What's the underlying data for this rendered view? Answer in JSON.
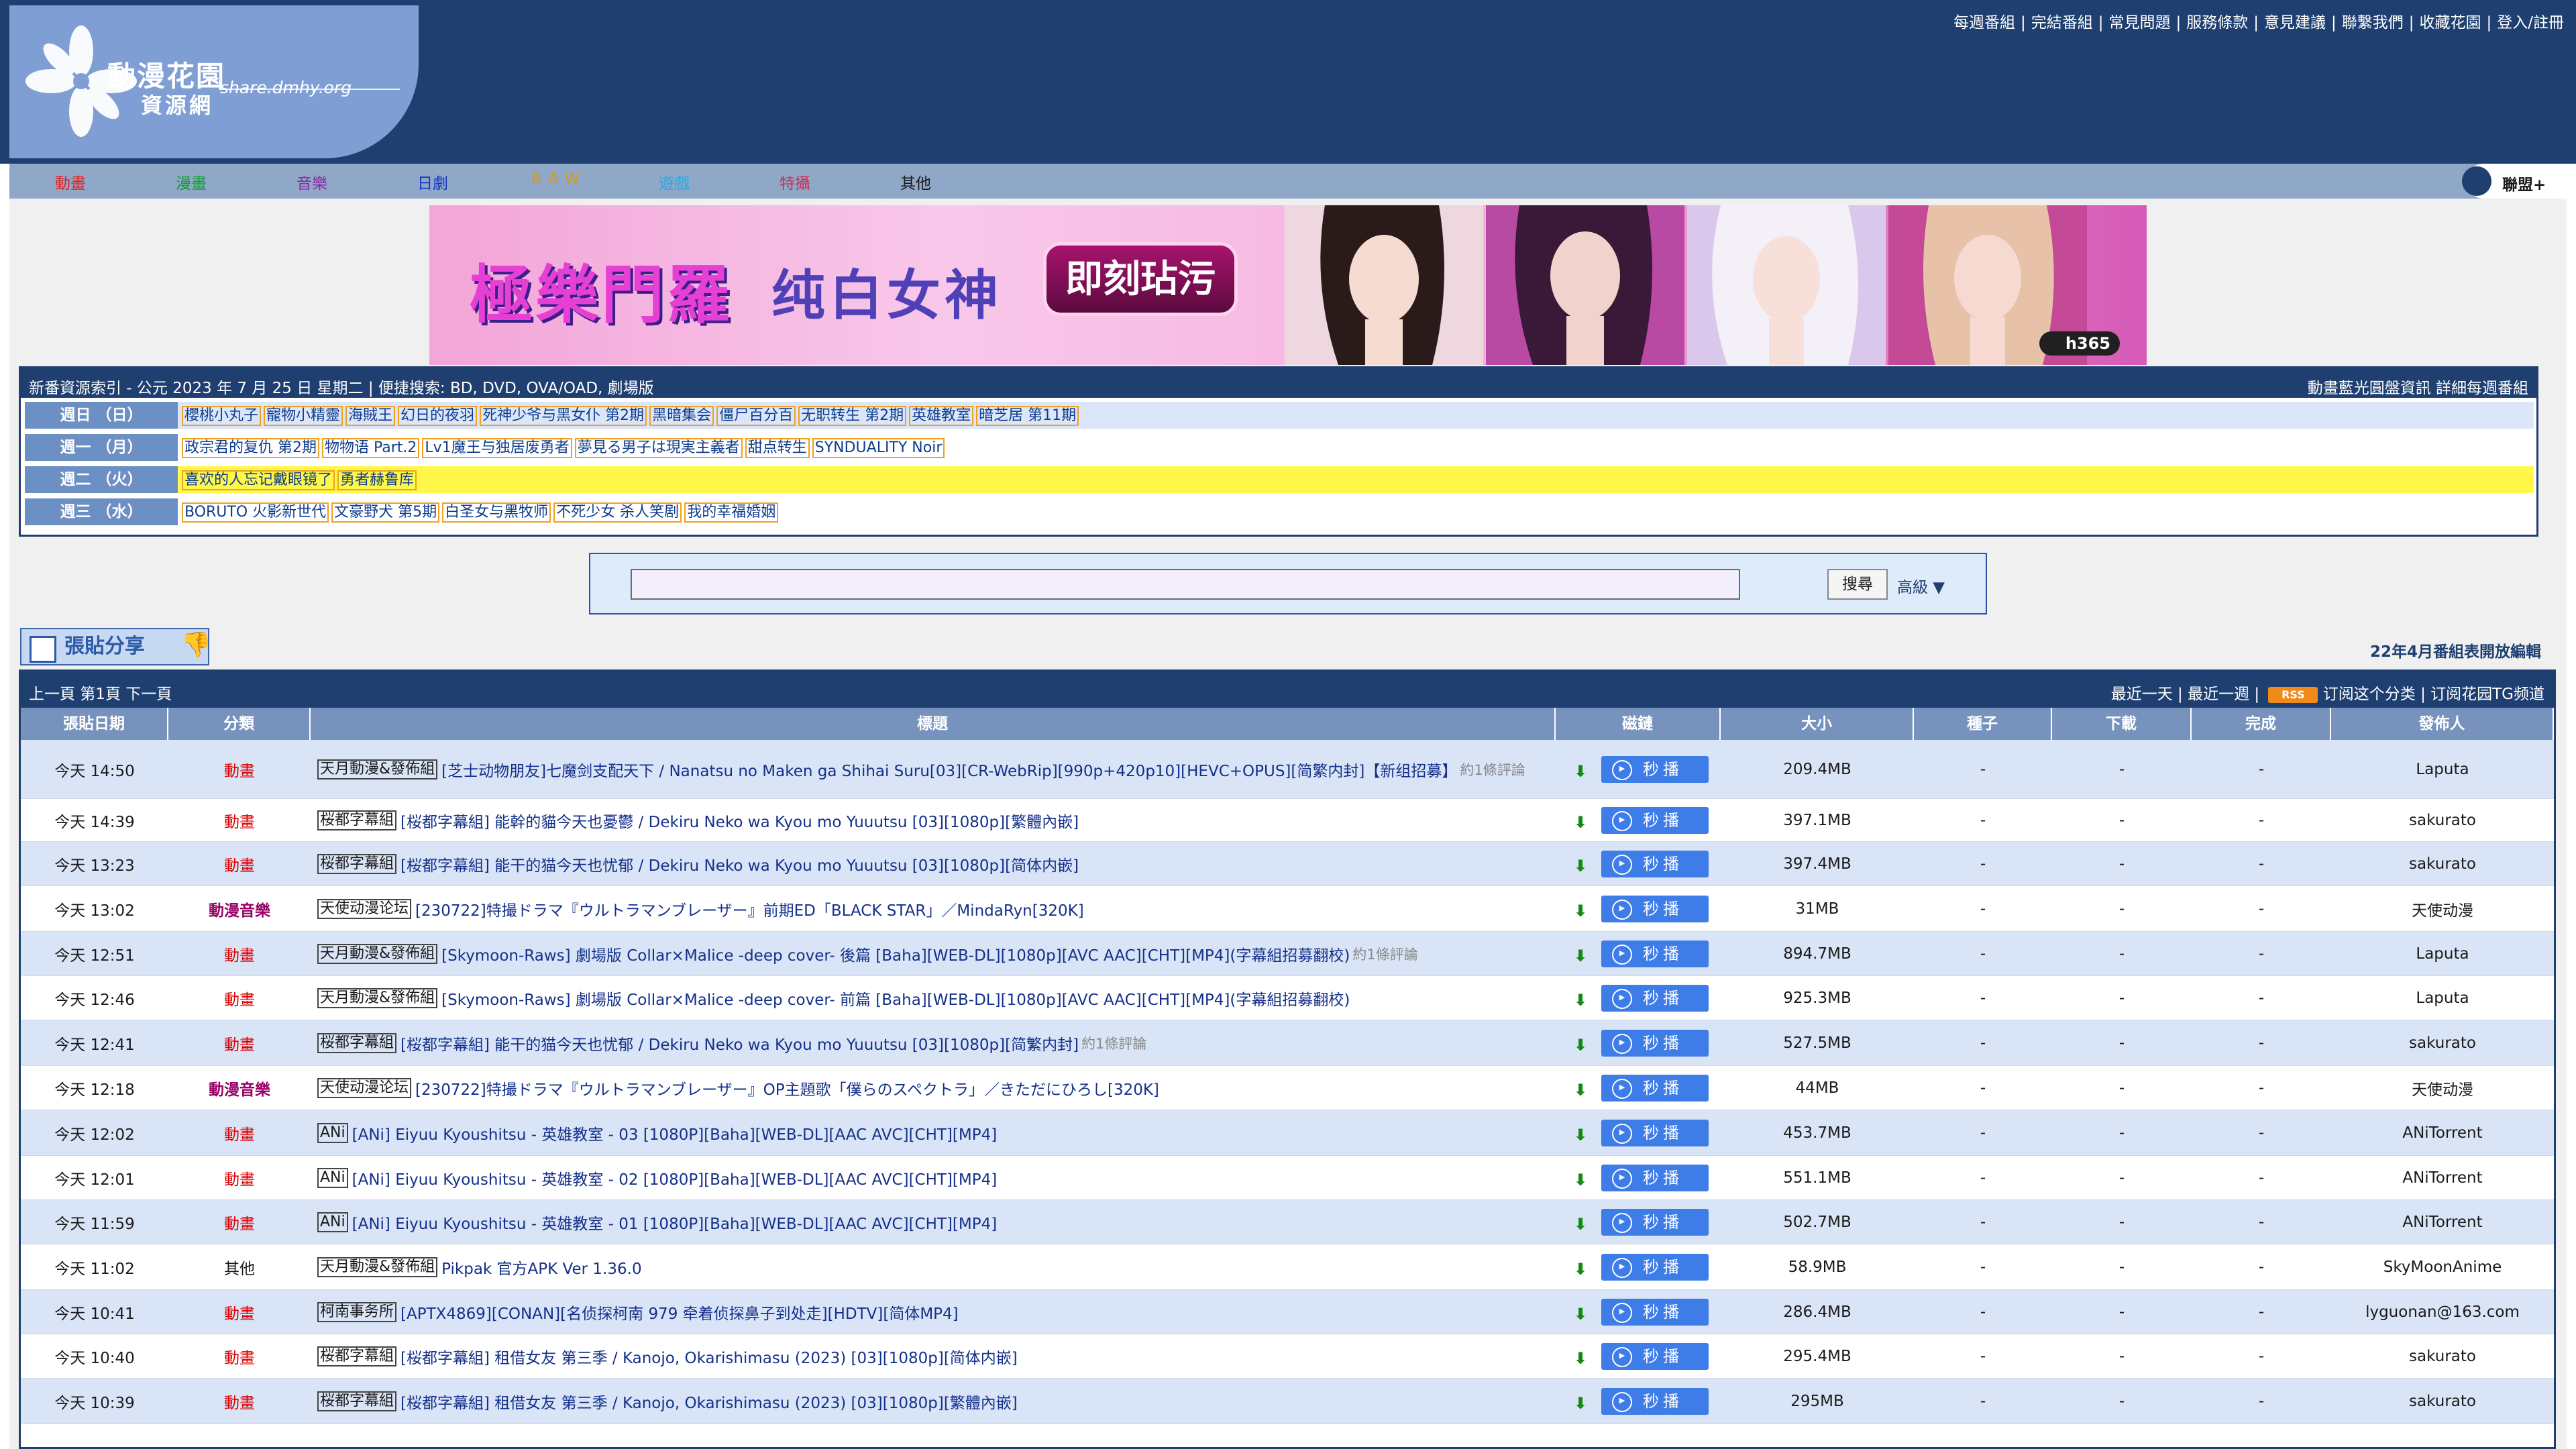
{
  "site": {
    "logo_title": "動漫花園",
    "logo_sub": "資源網",
    "logo_domain": "share.dmhy.org"
  },
  "top_links": [
    "每週番組",
    "完結番組",
    "常見問題",
    "服務條款",
    "意見建議",
    "聯繫我們",
    "收藏花園",
    "登入/註冊"
  ],
  "nav": {
    "items": [
      {
        "label": "動畫",
        "color": "#e02020"
      },
      {
        "label": "漫畫",
        "color": "#13a02a"
      },
      {
        "label": "音樂",
        "color": "#8a2aa8"
      },
      {
        "label": "日劇",
        "color": "#1437c8"
      },
      {
        "label": "RAW",
        "color": "#d89a18"
      },
      {
        "label": "遊戲",
        "color": "#2aa8e0"
      },
      {
        "label": "特攝",
        "color": "#c8305a"
      },
      {
        "label": "其他",
        "color": "#1a1a1a"
      }
    ],
    "alliance": "聯盟+"
  },
  "banner": {
    "brand": "極樂門羅",
    "slogan": "纯白女神",
    "cta": "即刻玷污",
    "tag": "h365"
  },
  "schedule": {
    "header": "新番資源索引 - 公元 2023 年 7 月 25 日 星期二 | 便捷搜索: BD, DVD, OVA/OAD, 劇場版",
    "header_right": "動畫藍光圓盤資訊 詳細每週番組",
    "days": [
      {
        "label": "週日 （日）",
        "shows": [
          "櫻桃小丸子",
          "寵物小精靈",
          "海賊王",
          "幻日的夜羽",
          "死神少爷与黑女仆 第2期",
          "黑暗集会",
          "僵尸百分百",
          "无职转生 第2期",
          "英雄教室",
          "暗芝居 第11期"
        ]
      },
      {
        "label": "週一 （月）",
        "shows": [
          "政宗君的复仇 第2期",
          "物物语 Part.2",
          "Lv1魔王与独居废勇者",
          "夢見る男子は現実主義者",
          "甜点转生",
          "SYNDUALITY Noir"
        ]
      },
      {
        "label": "週二 （火）",
        "shows": [
          "喜欢的人忘记戴眼镜了",
          "勇者赫鲁库"
        ]
      },
      {
        "label": "週三 （水）",
        "shows": [
          "BORUTO 火影新世代",
          "文豪野犬 第5期",
          "白圣女与黑牧师",
          "不死少女 杀人笑剧",
          "我的幸福婚姻"
        ]
      }
    ]
  },
  "search": {
    "placeholder": "",
    "button": "搜尋",
    "advanced": "高級 ▼"
  },
  "post_share": "張貼分享",
  "open_notice": "22年4月番組表開放編輯",
  "pager": {
    "left": "上一頁 第1頁 下一頁",
    "recent_day": "最近一天",
    "recent_week": "最近一週",
    "rss": "RSS",
    "subscribe": "订阅这个分类",
    "tg": "订阅花园TG频道"
  },
  "columns": [
    "張貼日期",
    "分類",
    "標題",
    "磁鏈",
    "大小",
    "種子",
    "下載",
    "完成",
    "發佈人"
  ],
  "play_label": "秒播",
  "rows": [
    {
      "date": "今天 14:50",
      "category": "動畫",
      "cat_type": "anime",
      "team": "天月動漫&發佈組",
      "title": "[芝士动物朋友]七魔剑支配天下 / Nanatsu no Maken ga Shihai Suru[03][CR-WebRip][990p+420p10][HEVC+OPUS][简繁内封]【新组招募】",
      "comment": "約1條評論",
      "size": "209.4MB",
      "seeds": "-",
      "downloads": "-",
      "done": "-",
      "publisher": "Laputa"
    },
    {
      "date": "今天 14:39",
      "category": "動畫",
      "cat_type": "anime",
      "team": "桜都字幕組",
      "title": "[桜都字幕組] 能幹的貓今天也憂鬱 / Dekiru Neko wa Kyou mo Yuuutsu [03][1080p][繁體內嵌]",
      "comment": "",
      "size": "397.1MB",
      "seeds": "-",
      "downloads": "-",
      "done": "-",
      "publisher": "sakurato"
    },
    {
      "date": "今天 13:23",
      "category": "動畫",
      "cat_type": "anime",
      "team": "桜都字幕組",
      "title": "[桜都字幕組] 能干的猫今天也忧郁 / Dekiru Neko wa Kyou mo Yuuutsu [03][1080p][简体内嵌]",
      "comment": "",
      "size": "397.4MB",
      "seeds": "-",
      "downloads": "-",
      "done": "-",
      "publisher": "sakurato"
    },
    {
      "date": "今天 13:02",
      "category": "動漫音樂",
      "cat_type": "music",
      "team": "天使动漫论坛",
      "title": "[230722]特撮ドラマ『ウルトラマンブレーザー』前期ED「BLACK STAR」／MindaRyn[320K]",
      "comment": "",
      "size": "31MB",
      "seeds": "-",
      "downloads": "-",
      "done": "-",
      "publisher": "天使动漫"
    },
    {
      "date": "今天 12:51",
      "category": "動畫",
      "cat_type": "anime",
      "team": "天月動漫&發佈組",
      "title": "[Skymoon-Raws] 劇場版 Collar×Malice -deep cover- 後篇 [Baha][WEB-DL][1080p][AVC AAC][CHT][MP4](字幕組招募翻校)",
      "comment": "約1條評論",
      "size": "894.7MB",
      "seeds": "-",
      "downloads": "-",
      "done": "-",
      "publisher": "Laputa"
    },
    {
      "date": "今天 12:46",
      "category": "動畫",
      "cat_type": "anime",
      "team": "天月動漫&發佈組",
      "title": "[Skymoon-Raws] 劇場版 Collar×Malice -deep cover- 前篇 [Baha][WEB-DL][1080p][AVC AAC][CHT][MP4](字幕組招募翻校)",
      "comment": "",
      "size": "925.3MB",
      "seeds": "-",
      "downloads": "-",
      "done": "-",
      "publisher": "Laputa"
    },
    {
      "date": "今天 12:41",
      "category": "動畫",
      "cat_type": "anime",
      "team": "桜都字幕組",
      "title": "[桜都字幕組] 能干的猫今天也忧郁 / Dekiru Neko wa Kyou mo Yuuutsu [03][1080p][简繁内封]",
      "comment": "約1條評論",
      "size": "527.5MB",
      "seeds": "-",
      "downloads": "-",
      "done": "-",
      "publisher": "sakurato"
    },
    {
      "date": "今天 12:18",
      "category": "動漫音樂",
      "cat_type": "music",
      "team": "天使动漫论坛",
      "title": "[230722]特撮ドラマ『ウルトラマンブレーザー』OP主題歌「僕らのスペクトラ」／きただにひろし[320K]",
      "comment": "",
      "size": "44MB",
      "seeds": "-",
      "downloads": "-",
      "done": "-",
      "publisher": "天使动漫"
    },
    {
      "date": "今天 12:02",
      "category": "動畫",
      "cat_type": "anime",
      "team": "ANi",
      "title": "[ANi] Eiyuu Kyoushitsu - 英雄教室 - 03 [1080P][Baha][WEB-DL][AAC AVC][CHT][MP4]",
      "comment": "",
      "size": "453.7MB",
      "seeds": "-",
      "downloads": "-",
      "done": "-",
      "publisher": "ANiTorrent"
    },
    {
      "date": "今天 12:01",
      "category": "動畫",
      "cat_type": "anime",
      "team": "ANi",
      "title": "[ANi] Eiyuu Kyoushitsu - 英雄教室 - 02 [1080P][Baha][WEB-DL][AAC AVC][CHT][MP4]",
      "comment": "",
      "size": "551.1MB",
      "seeds": "-",
      "downloads": "-",
      "done": "-",
      "publisher": "ANiTorrent"
    },
    {
      "date": "今天 11:59",
      "category": "動畫",
      "cat_type": "anime",
      "team": "ANi",
      "title": "[ANi] Eiyuu Kyoushitsu - 英雄教室 - 01 [1080P][Baha][WEB-DL][AAC AVC][CHT][MP4]",
      "comment": "",
      "size": "502.7MB",
      "seeds": "-",
      "downloads": "-",
      "done": "-",
      "publisher": "ANiTorrent"
    },
    {
      "date": "今天 11:02",
      "category": "其他",
      "cat_type": "other",
      "team": "天月動漫&發佈組",
      "title": "Pikpak 官方APK Ver 1.36.0",
      "comment": "",
      "size": "58.9MB",
      "seeds": "-",
      "downloads": "-",
      "done": "-",
      "publisher": "SkyMoonAnime"
    },
    {
      "date": "今天 10:41",
      "category": "動畫",
      "cat_type": "anime",
      "team": "柯南事务所",
      "title": "[APTX4869][CONAN][名侦探柯南 979 牵着侦探鼻子到处走][HDTV][简体MP4]",
      "comment": "",
      "size": "286.4MB",
      "seeds": "-",
      "downloads": "-",
      "done": "-",
      "publisher": "lyguonan@163.com"
    },
    {
      "date": "今天 10:40",
      "category": "動畫",
      "cat_type": "anime",
      "team": "桜都字幕組",
      "title": "[桜都字幕組] 租借女友 第三季 / Kanojo, Okarishimasu (2023) [03][1080p][简体内嵌]",
      "comment": "",
      "size": "295.4MB",
      "seeds": "-",
      "downloads": "-",
      "done": "-",
      "publisher": "sakurato"
    },
    {
      "date": "今天 10:39",
      "category": "動畫",
      "cat_type": "anime",
      "team": "桜都字幕組",
      "title": "[桜都字幕組] 租借女友 第三季 / Kanojo, Okarishimasu (2023) [03][1080p][繁體內嵌]",
      "comment": "",
      "size": "295MB",
      "seeds": "-",
      "downloads": "-",
      "done": "-",
      "publisher": "sakurato"
    }
  ]
}
